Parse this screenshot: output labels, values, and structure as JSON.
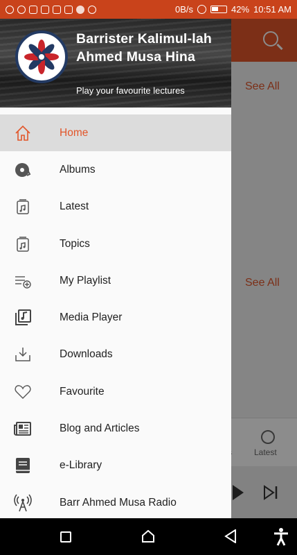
{
  "status_bar": {
    "network_speed": "0B/s",
    "battery_percent": "42%",
    "time": "10:51 AM"
  },
  "drawer": {
    "title": "Barrister Kalimul-lah Ahmed Musa Hina",
    "subtitle": "Play your favourite lectures",
    "items": [
      {
        "label": "Home",
        "icon": "home-icon",
        "active": true
      },
      {
        "label": "Albums",
        "icon": "album-disc-icon"
      },
      {
        "label": "Latest",
        "icon": "music-library-icon"
      },
      {
        "label": "Topics",
        "icon": "music-library-icon"
      },
      {
        "label": "My Playlist",
        "icon": "playlist-add-icon"
      },
      {
        "label": "Media Player",
        "icon": "media-player-icon"
      },
      {
        "label": "Downloads",
        "icon": "download-icon"
      },
      {
        "label": "Favourite",
        "icon": "heart-icon"
      },
      {
        "label": "Blog and Articles",
        "icon": "newspaper-icon"
      },
      {
        "label": "e-Library",
        "icon": "book-icon"
      },
      {
        "label": "Barr Ahmed Musa Radio",
        "icon": "radio-tower-icon"
      }
    ]
  },
  "background": {
    "see_all_1": "See All",
    "see_all_2": "See All",
    "tab_partial": "s",
    "tab_latest": "Latest"
  },
  "colors": {
    "accent": "#E2562A",
    "status_bar": "#C9431B",
    "active_row": "#DCDCDC"
  }
}
